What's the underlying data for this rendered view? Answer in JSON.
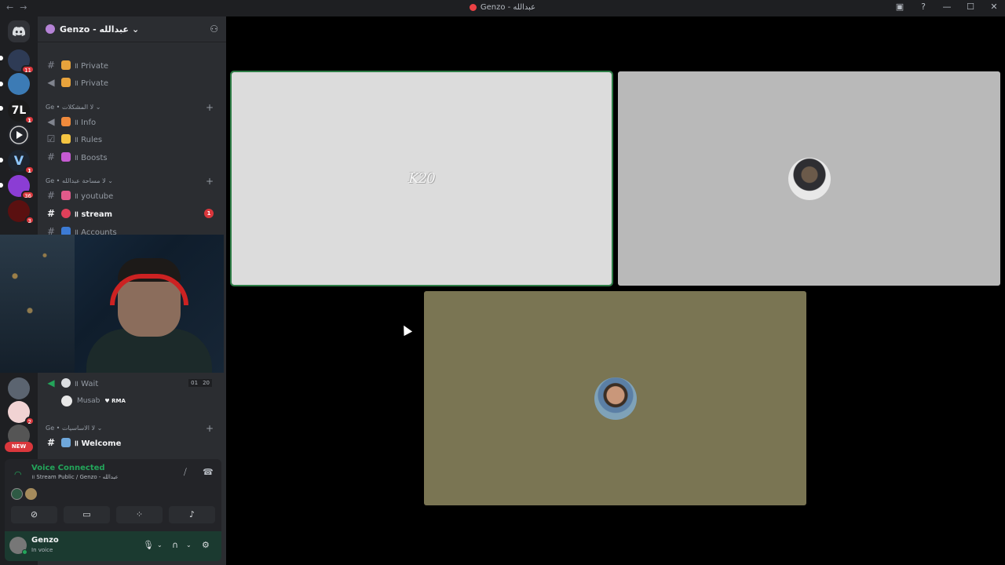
{
  "window": {
    "title": "Genzo - عبدالله",
    "nav_back": "←",
    "nav_forward": "→",
    "controls": [
      "—",
      "☐",
      "✕"
    ]
  },
  "server": {
    "name": "Genzo - عبدالله",
    "chevron": "⌄",
    "add_member_icon": "person-add-icon"
  },
  "channels": [
    {
      "type": "text",
      "label": "॥ Private",
      "icon": "lock-icon"
    },
    {
      "type": "voice",
      "label": "॥ Private",
      "icon": "lock-icon"
    },
    {
      "type": "category",
      "label": "Ge • لا المشكلات ⌄"
    },
    {
      "type": "announce",
      "label": "॥ Info",
      "icon": "bell-icon"
    },
    {
      "type": "rules",
      "label": "॥ Rules",
      "icon": "bell-icon"
    },
    {
      "type": "text",
      "label": "॥ Boosts",
      "icon": "diamond-icon"
    },
    {
      "type": "category",
      "label": "Ge • لا مساحة عبدالله ⌄"
    },
    {
      "type": "text",
      "label": "॥ youtube",
      "icon": "megaphone-icon"
    },
    {
      "type": "text",
      "label": "॥ stream",
      "icon": "record-icon",
      "unread": "1"
    },
    {
      "type": "text",
      "label": "॥ Accounts",
      "icon": "card-icon"
    }
  ],
  "voice_channel": {
    "label": "॥ Wait",
    "tag1": "01",
    "tag2": "20",
    "member_name": "Musab",
    "member_tag": "♥ RMA"
  },
  "category_basics": "Ge • لا الاساسيات ⌄",
  "welcome": "॥ Welcome",
  "guild_badges": [
    "11",
    "1",
    "1",
    "36",
    "3",
    "2"
  ],
  "new_badge": "NEW",
  "voice_status": {
    "title": "Voice Connected",
    "subtitle": "॥ Stream Public / Genzo - عبدالله"
  },
  "user": {
    "name": "Genzo",
    "status": "In voice"
  },
  "tiles": [
    {
      "name": "tile-1",
      "bg": "#dcdcdc",
      "logo": "K20",
      "speaking": true
    },
    {
      "name": "tile-2",
      "bg": "#b9b9b9",
      "avatar": "avatar-2"
    },
    {
      "name": "tile-3",
      "bg": "#7a7553",
      "avatar": "avatar-3"
    }
  ],
  "colors": {
    "accent_green": "#23a55a",
    "danger": "#da373c",
    "sidebar": "#2b2d31",
    "guilds": "#1e1f22"
  }
}
